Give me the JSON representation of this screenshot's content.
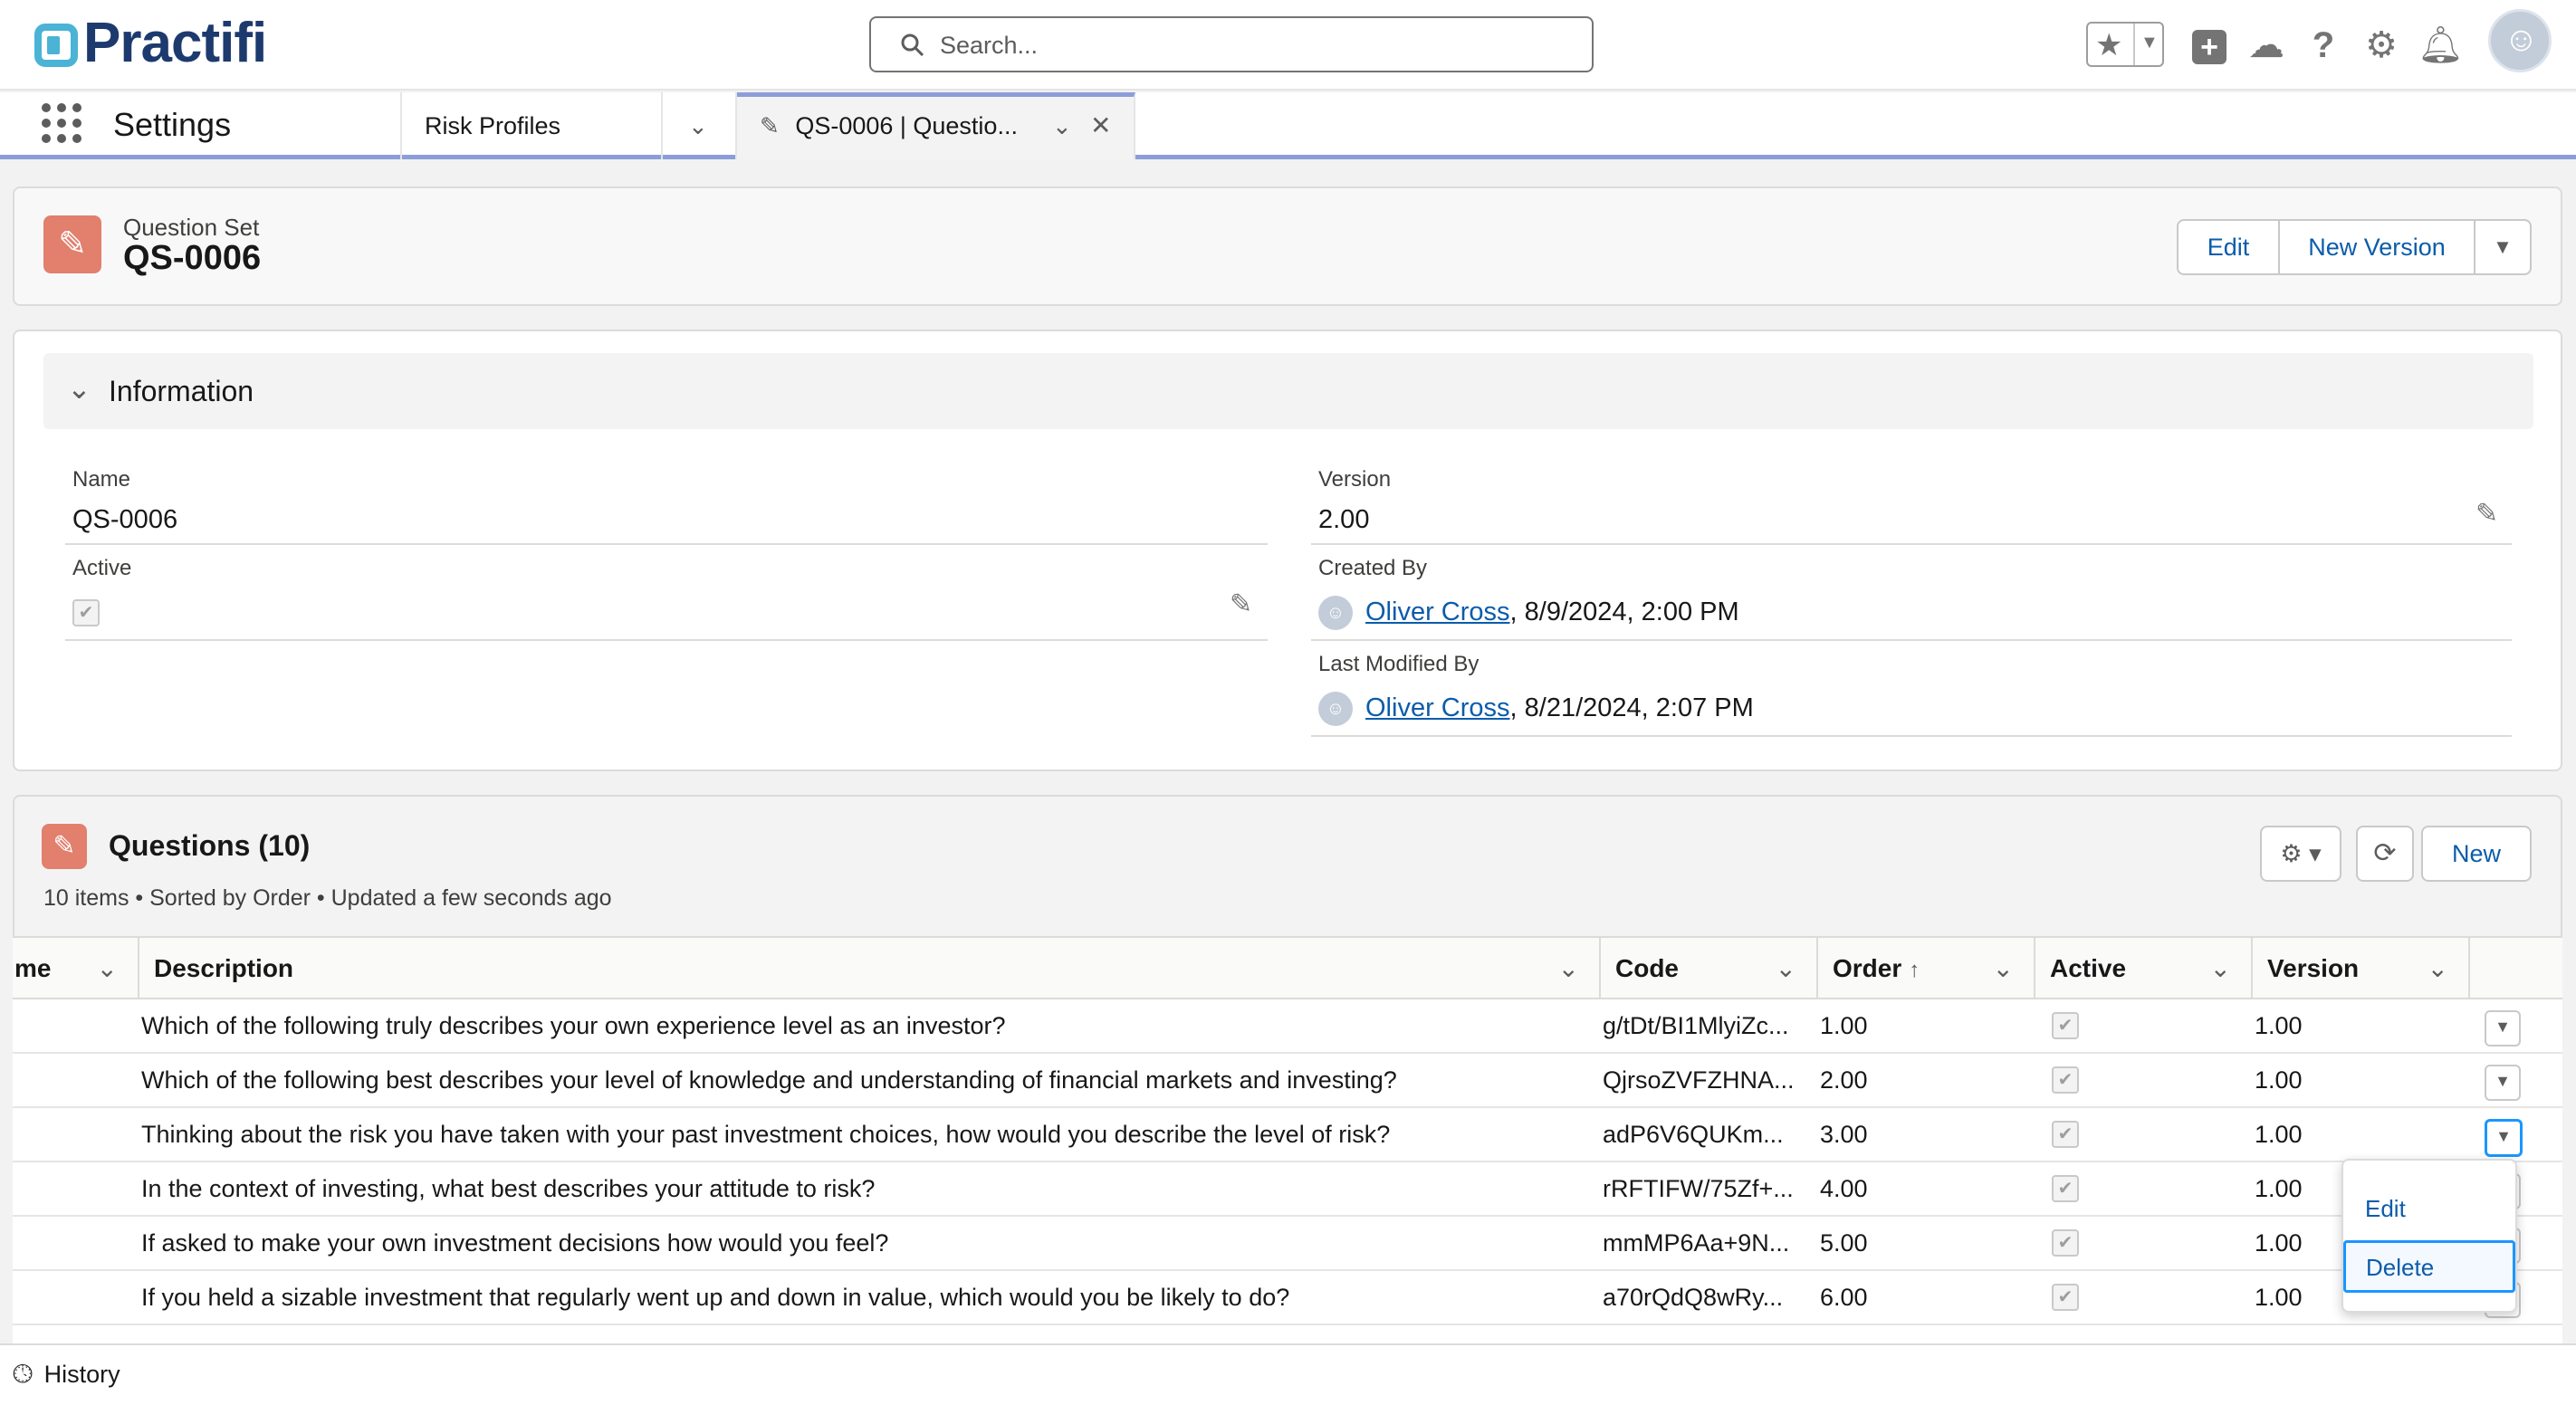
{
  "brand": {
    "name": "Practifi"
  },
  "search": {
    "placeholder": "Search..."
  },
  "nav": {
    "app_name": "Settings",
    "tabs": [
      {
        "label": "Risk Profiles"
      },
      {
        "label": "QS-0006 | Questio..."
      }
    ]
  },
  "record": {
    "object": "Question Set",
    "title": "QS-0006",
    "actions": [
      "Edit",
      "New Version"
    ]
  },
  "info": {
    "section": "Information",
    "name_label": "Name",
    "name_value": "QS-0006",
    "active_label": "Active",
    "active_value": true,
    "version_label": "Version",
    "version_value": "2.00",
    "created_label": "Created By",
    "created_user": "Oliver Cross",
    "created_date": ", 8/9/2024, 2:00 PM",
    "modified_label": "Last Modified By",
    "modified_user": "Oliver Cross",
    "modified_date": ", 8/21/2024, 2:07 PM"
  },
  "questions": {
    "title": "Questions (10)",
    "meta": "10 items • Sorted by Order • Updated a few seconds ago",
    "new_label": "New",
    "columns": {
      "name": "me",
      "description": "Description",
      "code": "Code",
      "order": "Order",
      "active": "Active",
      "version": "Version"
    },
    "rows": [
      {
        "description": "Which of the following truly describes your own experience level as an investor?",
        "code": "g/tDt/BI1MlyiZc...",
        "order": "1.00",
        "active": true,
        "version": "1.00"
      },
      {
        "description": "Which of the following best describes your level of knowledge and understanding of financial markets and investing?",
        "code": "QjrsoZVFZHNA...",
        "order": "2.00",
        "active": true,
        "version": "1.00"
      },
      {
        "description": "Thinking about the risk you have taken with your past investment choices, how would you describe the level of risk?",
        "code": "adP6V6QUKm...",
        "order": "3.00",
        "active": true,
        "version": "1.00"
      },
      {
        "description": "In the context of investing, what best describes your attitude to risk?",
        "code": "rRFTIFW/75Zf+...",
        "order": "4.00",
        "active": true,
        "version": "1.00"
      },
      {
        "description": "If asked to make your own investment decisions how would you feel?",
        "code": "mmMP6Aa+9N...",
        "order": "5.00",
        "active": true,
        "version": "1.00"
      },
      {
        "description": "If you held a sizable investment that regularly went up and down in value, which would you be likely to do?",
        "code": "a70rQdQ8wRy...",
        "order": "6.00",
        "active": true,
        "version": "1.00"
      }
    ],
    "row_menu": [
      "Edit",
      "Delete"
    ]
  },
  "footer": {
    "history_label": "History"
  },
  "colors": {
    "accent": "#0b5cab",
    "record_icon": "#e27f6d",
    "nav_underline": "#8b9ed9"
  }
}
